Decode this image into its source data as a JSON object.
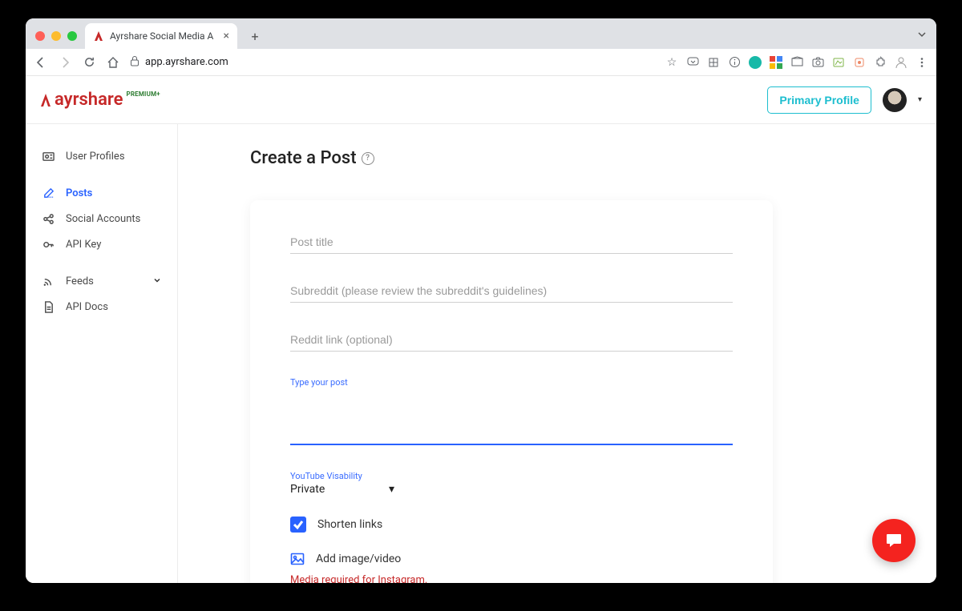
{
  "browser": {
    "tab_title": "Ayrshare Social Media API Das",
    "url_display": "app.ayrshare.com"
  },
  "header": {
    "logo_text": "ayrshare",
    "badge": "PREMIUM+",
    "primary_button": "Primary Profile"
  },
  "sidebar": {
    "items": [
      {
        "label": "User Profiles"
      },
      {
        "label": "Posts"
      },
      {
        "label": "Social Accounts"
      },
      {
        "label": "API Key"
      },
      {
        "label": "Feeds"
      },
      {
        "label": "API Docs"
      }
    ]
  },
  "page": {
    "title": "Create a Post",
    "help": "?"
  },
  "form": {
    "title_placeholder": "Post title",
    "subreddit_placeholder": "Subreddit (please review the subreddit's guidelines)",
    "reddit_link_placeholder": "Reddit link (optional)",
    "post_label": "Type your post",
    "yt_label": "YouTube Visability",
    "yt_value": "Private",
    "shorten_label": "Shorten links",
    "add_media_label": "Add image/video",
    "media_warning": "Media required for Instagram."
  }
}
